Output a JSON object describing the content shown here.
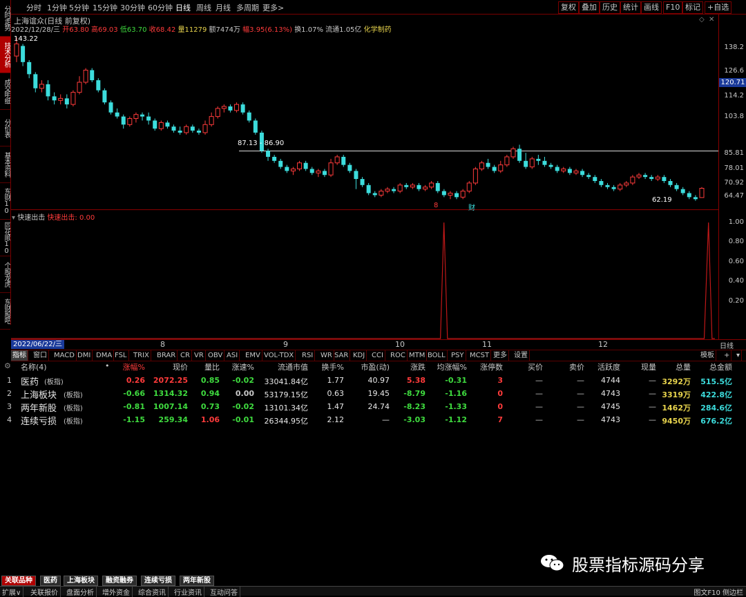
{
  "left_tabs": [
    "分时走势",
    "技术分析",
    "成交明细",
    "分价表",
    "基本资料",
    "东财10",
    "同花顺10",
    "个股龙虎",
    "东财股吧"
  ],
  "periods": [
    "分时",
    "1分钟",
    "5分钟",
    "15分钟",
    "30分钟",
    "60分钟",
    "日线",
    "周线",
    "月线",
    "多周期",
    "更多>"
  ],
  "toolbar": [
    "复权",
    "叠加",
    "历史",
    "统计",
    "画线",
    "F10",
    "标记",
    "+自选"
  ],
  "stock": {
    "title": "上海谊众(日线 前复权)",
    "date": "2022/12/28/三",
    "open_label": "开",
    "open": "63.80",
    "high_label": "高",
    "high": "69.03",
    "low_label": "低",
    "low": "63.70",
    "close_label": "收",
    "close": "68.42",
    "vol_label": "量",
    "vol": "11279",
    "amt_label": "额",
    "amt": "7474万",
    "chg_label": "幅",
    "chg": "3.95(6.13%)",
    "turnover": "换1.07%",
    "float": "流通1.05亿",
    "industry": "化学制药"
  },
  "price_axis": [
    "138.2",
    "126.6",
    "114.2",
    "103.8",
    "85.81",
    "78.01",
    "70.92",
    "64.47"
  ],
  "price_tag": "120.71",
  "annotations": {
    "max": "143.22",
    "min": "62.19",
    "range": "87.13 - 86.90",
    "mark1": "8",
    "mark2": "财"
  },
  "indicator": {
    "name": "快速出击",
    "value_label": "快速出击: 0.00",
    "axis": [
      "1.00",
      "0.80",
      "0.60",
      "0.40",
      "0.20"
    ]
  },
  "date_axis": {
    "start": "2022/06/22/三",
    "months": [
      "8",
      "9",
      "10",
      "11",
      "12"
    ],
    "period": "日线"
  },
  "indicator_tabs": [
    "指标",
    "窗口",
    "MACD",
    "DMI",
    "DMA",
    "FSL",
    "TRIX",
    "BRAR",
    "CR",
    "VR",
    "OBV",
    "ASI",
    "EMV",
    "VOL-TDX",
    "RSI",
    "WR",
    "SAR",
    "KDJ",
    "CCI",
    "ROC",
    "MTM",
    "BOLL",
    "PSY",
    "MCST",
    "更多",
    "设置"
  ],
  "template_tab": "模板",
  "table": {
    "headers": [
      "名称(4)",
      "•",
      "涨幅%",
      "现价",
      "量比",
      "涨速%",
      "流通市值",
      "换手%",
      "市盈(动)",
      "涨跌",
      "均涨幅%",
      "涨停数",
      "买价",
      "卖价",
      "活跃度",
      "现量",
      "总量",
      "总金额"
    ],
    "rows": [
      {
        "idx": "1",
        "name": "医药",
        "tag": "(板指)",
        "chg": "0.26",
        "price": "2072.25",
        "ratio": "0.85",
        "speed": "-0.02",
        "mcap": "33041.84亿",
        "turn": "1.77",
        "pe": "40.97",
        "diff": "5.38",
        "avg": "-0.31",
        "limit": "3",
        "bid": "—",
        "ask": "—",
        "active": "4744",
        "cur": "—",
        "vol": "3292万",
        "amt": "515.5亿"
      },
      {
        "idx": "2",
        "name": "上海板块",
        "tag": "(板指)",
        "chg": "-0.66",
        "price": "1314.32",
        "ratio": "0.94",
        "speed": "0.00",
        "mcap": "53179.15亿",
        "turn": "0.63",
        "pe": "19.45",
        "diff": "-8.79",
        "avg": "-1.16",
        "limit": "0",
        "bid": "—",
        "ask": "—",
        "active": "4743",
        "cur": "—",
        "vol": "3319万",
        "amt": "422.8亿"
      },
      {
        "idx": "3",
        "name": "两年新股",
        "tag": "(板指)",
        "chg": "-0.81",
        "price": "1007.14",
        "ratio": "0.73",
        "speed": "-0.02",
        "mcap": "13101.34亿",
        "turn": "1.47",
        "pe": "24.74",
        "diff": "-8.23",
        "avg": "-1.33",
        "limit": "0",
        "bid": "—",
        "ask": "—",
        "active": "4745",
        "cur": "—",
        "vol": "1462万",
        "amt": "284.6亿"
      },
      {
        "idx": "4",
        "name": "连续亏损",
        "tag": "(板指)",
        "chg": "-1.15",
        "price": "259.34",
        "ratio": "1.06",
        "speed": "-0.01",
        "mcap": "26344.95亿",
        "turn": "2.12",
        "pe": "—",
        "diff": "-3.03",
        "avg": "-1.12",
        "limit": "7",
        "bid": "—",
        "ask": "—",
        "active": "4743",
        "cur": "—",
        "vol": "9450万",
        "amt": "676.2亿"
      }
    ]
  },
  "bottom_tabs": [
    "关联品种",
    "医药",
    "上海板块",
    "融资融券",
    "连续亏损",
    "两年新股"
  ],
  "status_tabs": [
    "扩展∨",
    "关联报价",
    "盘面分析",
    "增外资金",
    "综合资讯",
    "行业资讯",
    "互动问答"
  ],
  "status_right": "图文F10 侧边栏",
  "watermark": "股票指标源码分享",
  "colors": {
    "up": "#ff3b3b",
    "down": "#3cdcdc",
    "rise": "#ff3b3b",
    "fall": "#3fdc3f",
    "accent": "#b00000",
    "yellow": "#e8d44d",
    "cyan": "#3cdcdc"
  },
  "chart_data": {
    "type": "candlestick",
    "ylim": [
      60,
      145
    ],
    "candles": [
      [
        134,
        140,
        131,
        143.2
      ],
      [
        139,
        131,
        129,
        140
      ],
      [
        131,
        125,
        123,
        132
      ],
      [
        125,
        118,
        116,
        126
      ],
      [
        118,
        120,
        116,
        122
      ],
      [
        120,
        114,
        112,
        122
      ],
      [
        114,
        112,
        110,
        116
      ],
      [
        112,
        113,
        110,
        115
      ],
      [
        113,
        110,
        108,
        115
      ],
      [
        110,
        116,
        109,
        117
      ],
      [
        116,
        121,
        115,
        124
      ],
      [
        121,
        127,
        120,
        128
      ],
      [
        127,
        122,
        121,
        128
      ],
      [
        122,
        117,
        116,
        123
      ],
      [
        117,
        111,
        110,
        118
      ],
      [
        111,
        106,
        105,
        112
      ],
      [
        106,
        104,
        103,
        108
      ],
      [
        104,
        100,
        98,
        105
      ],
      [
        100,
        103,
        99,
        104
      ],
      [
        103,
        105,
        101,
        106
      ],
      [
        105,
        104,
        102,
        106
      ],
      [
        104,
        102,
        100,
        106
      ],
      [
        102,
        98,
        97,
        103
      ],
      [
        98,
        101,
        97,
        102
      ],
      [
        101,
        99,
        98,
        102
      ],
      [
        99,
        97,
        96,
        100
      ],
      [
        97,
        96,
        95,
        99
      ],
      [
        96,
        99,
        95,
        100
      ],
      [
        99,
        97,
        96,
        100
      ],
      [
        97,
        96,
        95,
        98
      ],
      [
        96,
        100,
        95,
        102
      ],
      [
        100,
        104,
        99,
        106
      ],
      [
        104,
        108,
        103,
        109
      ],
      [
        108,
        109,
        106,
        110
      ],
      [
        109,
        107,
        106,
        110
      ],
      [
        107,
        110,
        106,
        111
      ],
      [
        110,
        106,
        105,
        111
      ],
      [
        106,
        102,
        101,
        107
      ],
      [
        102,
        96,
        95,
        103
      ],
      [
        96,
        87,
        86,
        97
      ],
      [
        87,
        84,
        82,
        88
      ],
      [
        84,
        82,
        81,
        85
      ],
      [
        82,
        79,
        78,
        83
      ],
      [
        79,
        77,
        76,
        80
      ],
      [
        77,
        78,
        75,
        79
      ],
      [
        78,
        81,
        77,
        82
      ],
      [
        81,
        78,
        77,
        82
      ],
      [
        78,
        76,
        75,
        79
      ],
      [
        76,
        77,
        74,
        78
      ],
      [
        77,
        75,
        74,
        78
      ],
      [
        75,
        81,
        74,
        83
      ],
      [
        81,
        84,
        80,
        85
      ],
      [
        84,
        80,
        79,
        85
      ],
      [
        80,
        77,
        76,
        81
      ],
      [
        77,
        73,
        68,
        78
      ],
      [
        73,
        70,
        69,
        74
      ],
      [
        70,
        66,
        65,
        71
      ],
      [
        66,
        65,
        64,
        67
      ],
      [
        65,
        67,
        64,
        68
      ],
      [
        67,
        68,
        66,
        69
      ],
      [
        68,
        67,
        66,
        69
      ],
      [
        67,
        70,
        66,
        71
      ],
      [
        70,
        69,
        68,
        71
      ],
      [
        69,
        70,
        68,
        71
      ],
      [
        70,
        68,
        67,
        71
      ],
      [
        68,
        69,
        67,
        70
      ],
      [
        69,
        71,
        68,
        72
      ],
      [
        71,
        67,
        66,
        72
      ],
      [
        67,
        65,
        64,
        68
      ],
      [
        65,
        66,
        63,
        67
      ],
      [
        66,
        64,
        63,
        67
      ],
      [
        64,
        67,
        63,
        68
      ],
      [
        67,
        71,
        66,
        72
      ],
      [
        71,
        78,
        70,
        79
      ],
      [
        78,
        81,
        77,
        82
      ],
      [
        81,
        79,
        78,
        83
      ],
      [
        79,
        77,
        76,
        80
      ],
      [
        77,
        80,
        76,
        82
      ],
      [
        80,
        84,
        79,
        85
      ],
      [
        84,
        88,
        83,
        89
      ],
      [
        88,
        82,
        81,
        90
      ],
      [
        82,
        79,
        78,
        86
      ],
      [
        79,
        83,
        78,
        84
      ],
      [
        83,
        82,
        80,
        85
      ],
      [
        82,
        80,
        79,
        84
      ],
      [
        80,
        79,
        78,
        81
      ],
      [
        79,
        77,
        76,
        80
      ],
      [
        77,
        78,
        76,
        79
      ],
      [
        78,
        76,
        75,
        79
      ],
      [
        76,
        77,
        75,
        78
      ],
      [
        77,
        75,
        74,
        78
      ],
      [
        75,
        74,
        73,
        76
      ],
      [
        74,
        72,
        71,
        75
      ],
      [
        72,
        70,
        69,
        73
      ],
      [
        70,
        69,
        68,
        71
      ],
      [
        69,
        68,
        67,
        70
      ],
      [
        68,
        70,
        67,
        71
      ],
      [
        70,
        71,
        69,
        72
      ],
      [
        71,
        74,
        70,
        75
      ],
      [
        74,
        75,
        73,
        76
      ],
      [
        75,
        74,
        73,
        76
      ],
      [
        74,
        73,
        72,
        75
      ],
      [
        73,
        74,
        72,
        75
      ],
      [
        74,
        72,
        71,
        75
      ],
      [
        72,
        70,
        69,
        73
      ],
      [
        70,
        68,
        67,
        71
      ],
      [
        68,
        66,
        65,
        69
      ],
      [
        66,
        64,
        63,
        67
      ],
      [
        64,
        63,
        62.2,
        65
      ],
      [
        63.8,
        68.4,
        63.7,
        69
      ]
    ],
    "signal": [
      [
        0,
        0
      ],
      [
        0.604,
        0
      ],
      [
        0.607,
        0
      ],
      [
        0.612,
        1.0
      ],
      [
        0.617,
        0
      ],
      [
        0.62,
        0
      ],
      [
        0.976,
        0
      ],
      [
        0.98,
        0
      ],
      [
        0.986,
        1.0
      ],
      [
        0.991,
        0
      ],
      [
        0.995,
        0
      ]
    ]
  }
}
